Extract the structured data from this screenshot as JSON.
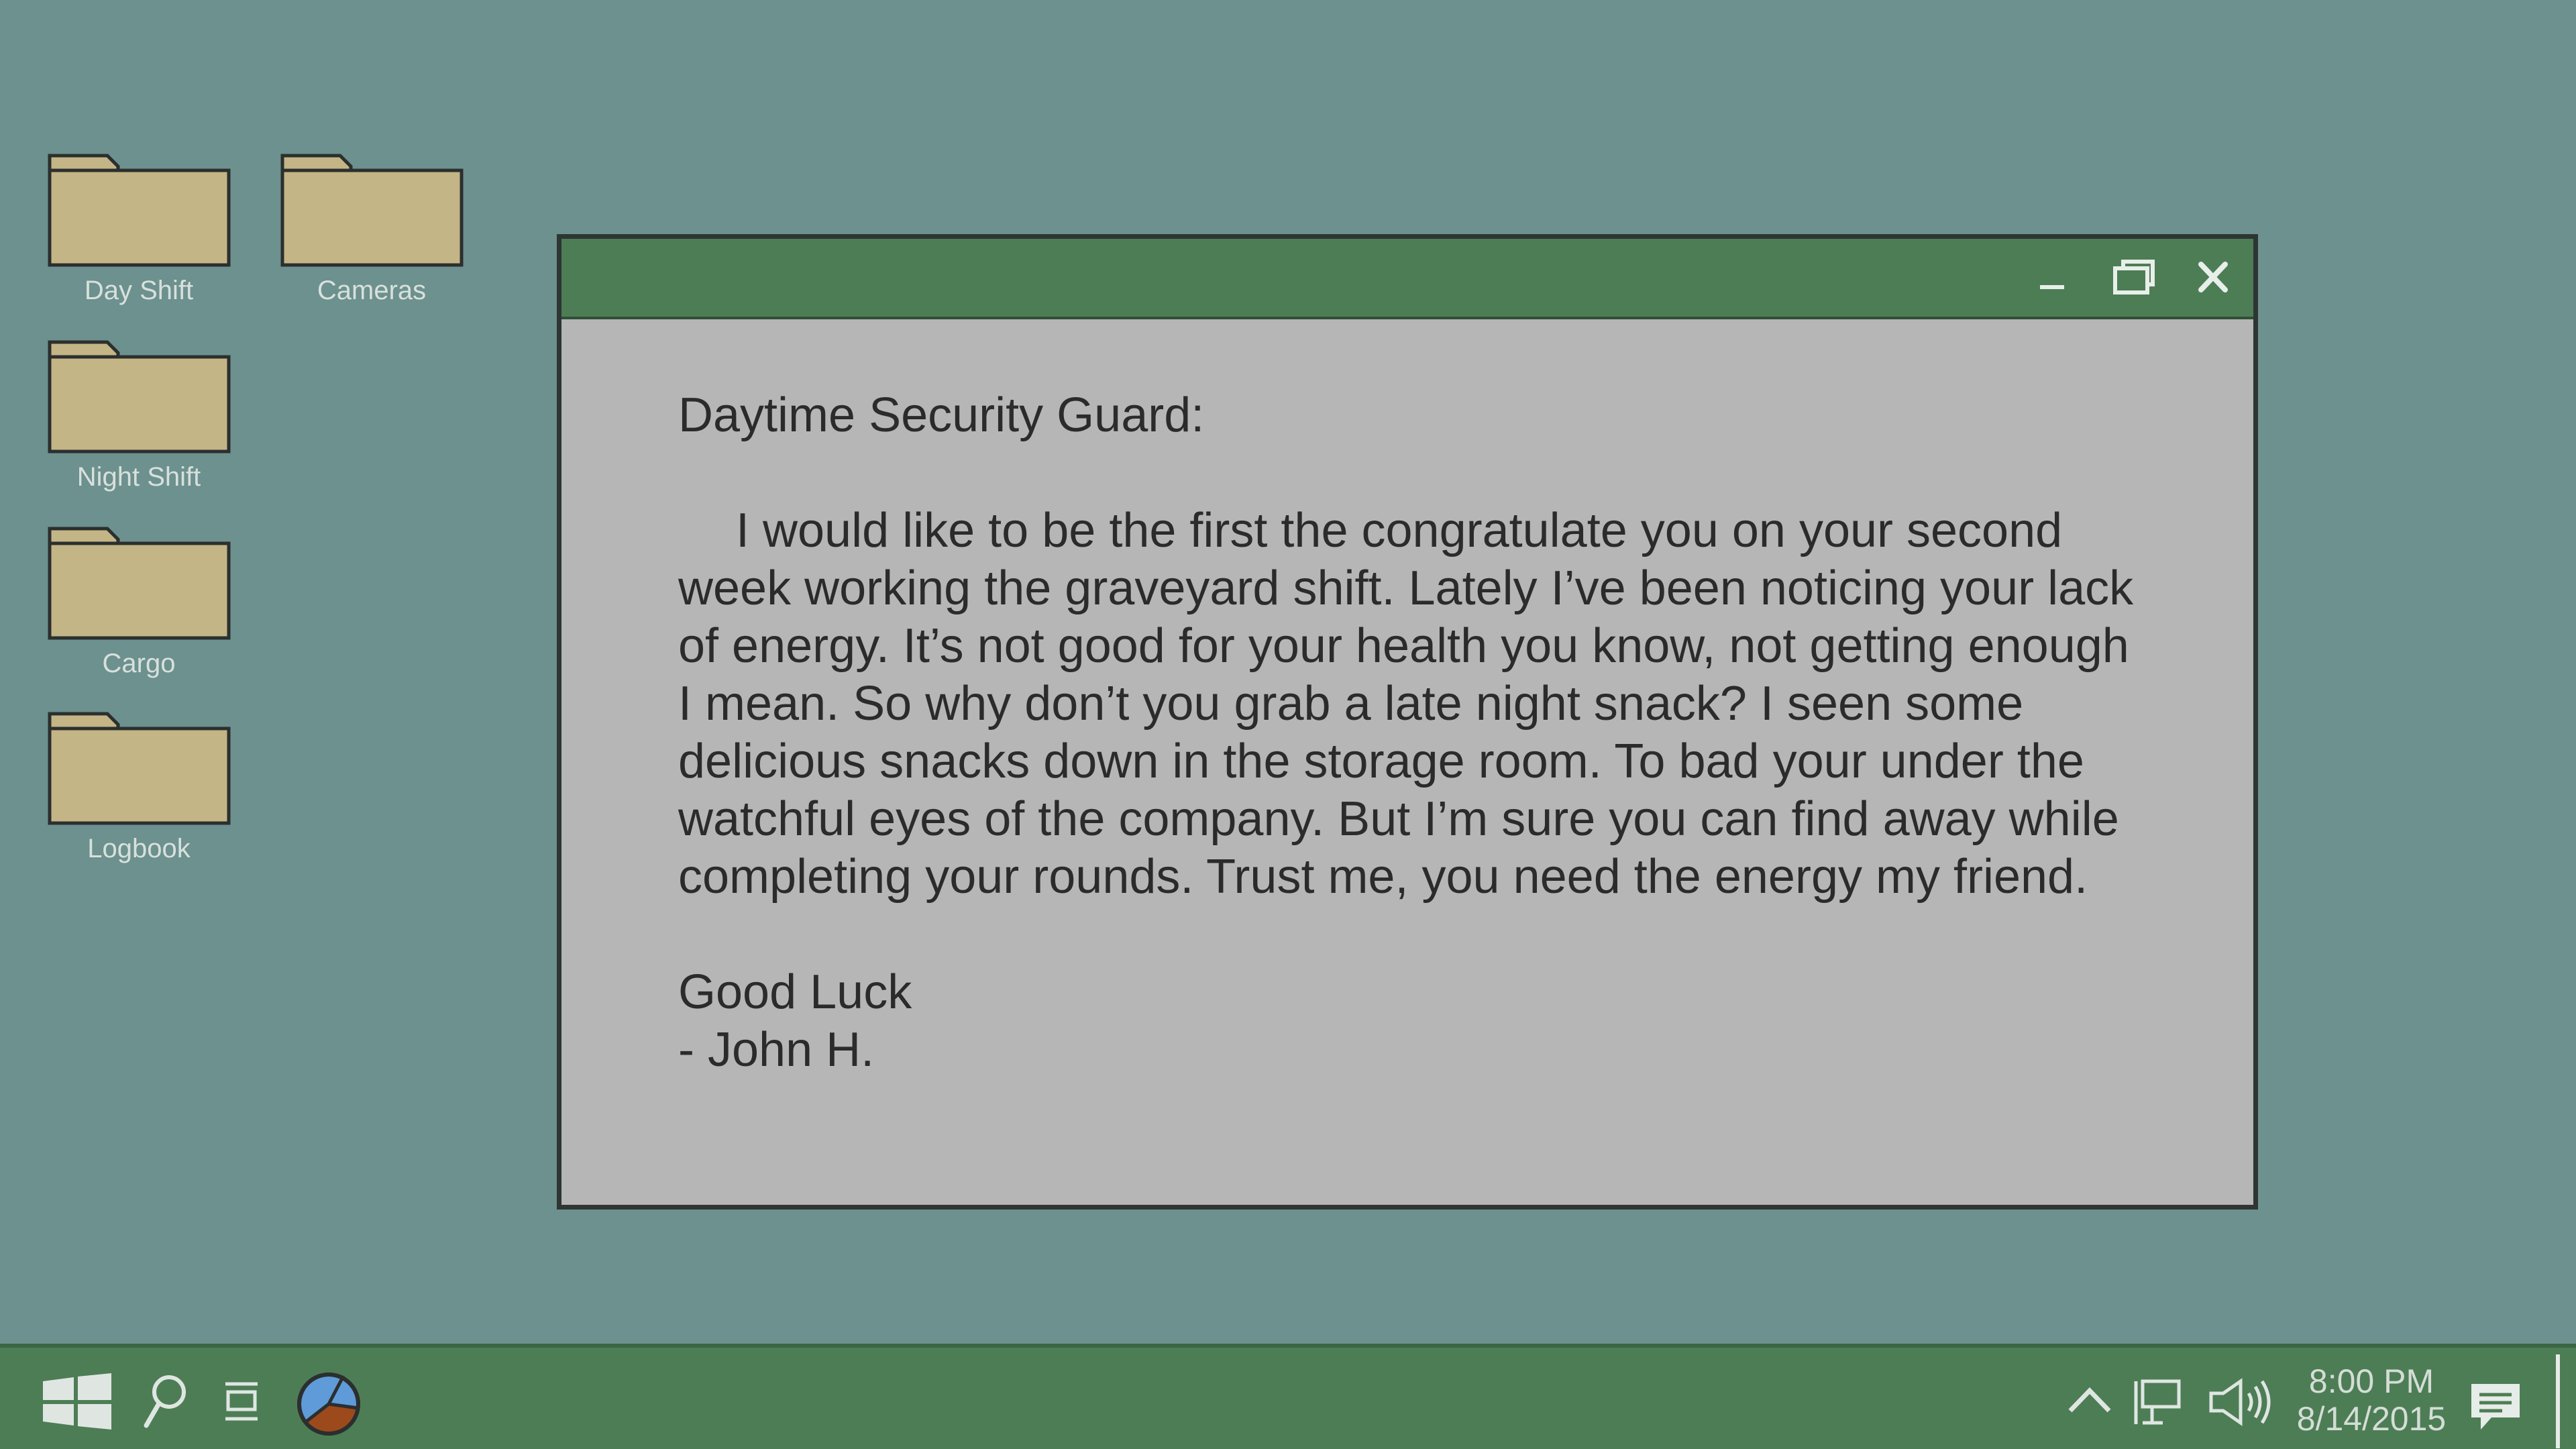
{
  "desktop": {
    "icons": [
      {
        "label": "Day Shift"
      },
      {
        "label": "Cameras"
      },
      {
        "label": "Night Shift"
      },
      {
        "label": "Cargo"
      },
      {
        "label": "Logbook"
      }
    ]
  },
  "window": {
    "controls": {
      "minimize_icon": "minimize-icon",
      "restore_icon": "restore-icon",
      "close_icon": "close-icon"
    },
    "letter": {
      "salutation": "Daytime Security Guard:",
      "body": "I would like to be the first the congratulate you on your second week working the graveyard shift. Lately I’ve been noticing your lack of energy. It’s not good for your health you know, not getting enough I mean. So why don’t you grab a late night snack? I seen some delicious snacks down in the storage room. To bad your under the watchful eyes of the company. But I’m sure you can find away while completing your rounds. Trust me, you need the energy my friend.",
      "closing": "Good Luck",
      "signature": "- John H."
    }
  },
  "taskbar": {
    "clock": {
      "time": "8:00 PM",
      "date": "8/14/2015"
    }
  },
  "colors": {
    "desktop_bg": "#6c918e",
    "taskbar_bg": "#4d7d55",
    "titlebar_bg": "#4d7d55",
    "window_bg": "#b6b6b6",
    "folder_fill": "#c4b586",
    "text_dark": "#2b2b2b"
  }
}
